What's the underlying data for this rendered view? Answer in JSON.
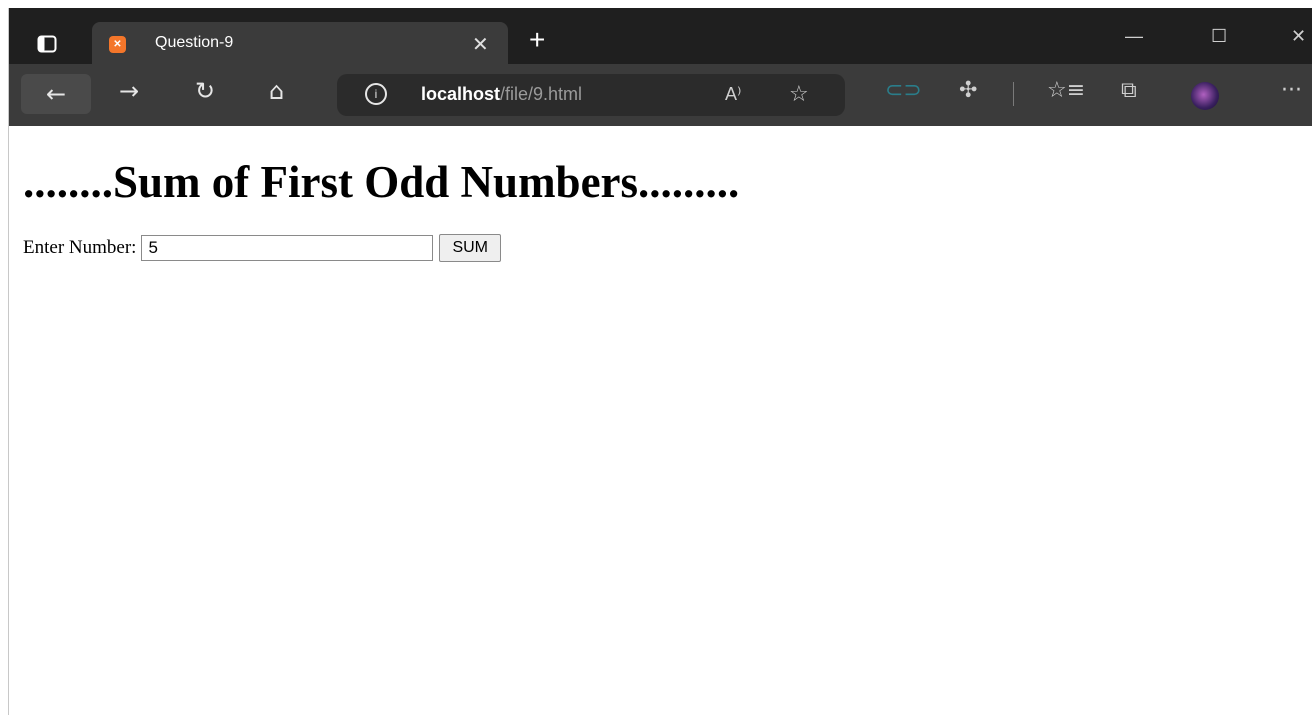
{
  "browser": {
    "tab": {
      "title": "Question-9",
      "favicon": "xampp-icon"
    },
    "address": {
      "host": "localhost",
      "path": "/file/9.html"
    }
  },
  "page": {
    "heading": "........Sum of First Odd Numbers.........",
    "input_label": "Enter Number:",
    "input_value": "5",
    "button_label": "SUM"
  }
}
